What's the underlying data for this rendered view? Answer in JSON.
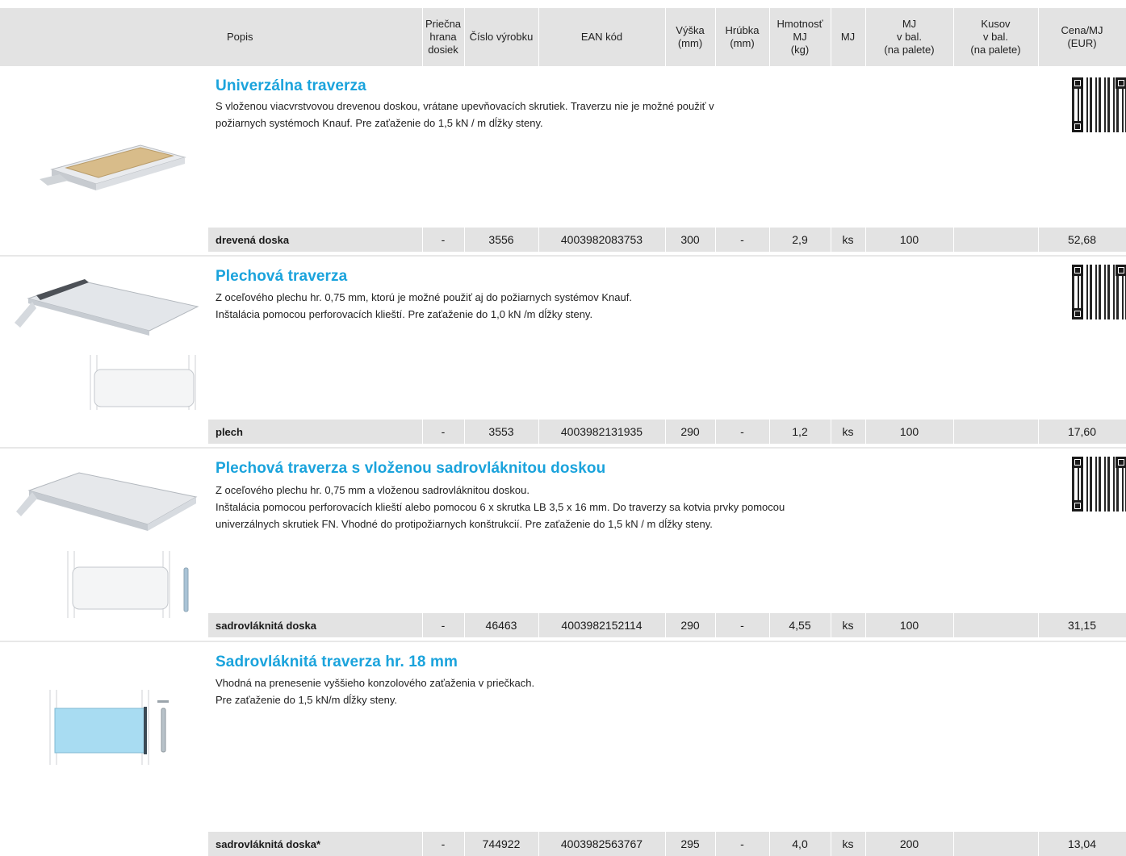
{
  "header": {
    "columns": [
      "Popis",
      "Priečna\nhrana\ndosiek",
      "Číslo výrobku",
      "EAN kód",
      "Výška\n(mm)",
      "Hrúbka\n(mm)",
      "Hmotnosť\nMJ\n(kg)",
      "MJ",
      "MJ\nv bal.\n(na palete)",
      "Kusov\nv bal.\n(na palete)",
      "Cena/MJ\n(EUR)"
    ]
  },
  "products": [
    {
      "title": "Univerzálna traverza",
      "desc": [
        "S vloženou viacvrstvovou drevenou doskou, vrátane upevňovacích skrutiek. Traverzu nie je možné použiť v",
        "požiarnych systémoch Knauf. Pre zaťaženie do 1,5 kN / m dĺžky steny."
      ],
      "row": [
        "drevená doska",
        "-",
        "3556",
        "4003982083753",
        "300",
        "-",
        "2,9",
        "ks",
        "100",
        "",
        "52,68"
      ]
    },
    {
      "title": "Plechová traverza",
      "desc": [
        "Z oceľového plechu hr. 0,75 mm, ktorú je možné použiť aj do požiarnych systémov Knauf.",
        "Inštalácia pomocou perforovacích klieští. Pre zaťaženie do 1,0 kN /m dĺžky steny."
      ],
      "row": [
        "plech",
        "-",
        "3553",
        "4003982131935",
        "290",
        "-",
        "1,2",
        "ks",
        "100",
        "",
        "17,60"
      ]
    },
    {
      "title": "Plechová traverza s vloženou sadrovláknitou doskou",
      "desc": [
        "Z oceľového plechu hr. 0,75 mm a vloženou sadrovláknitou doskou.",
        "Inštalácia pomocou perforovacích klieští alebo pomocou 6 x skrutka LB 3,5 x 16 mm. Do traverzy sa kotvia prvky pomocou",
        "univerzálnych skrutiek FN. Vhodné do protipožiarnych konštrukcií. Pre zaťaženie do 1,5 kN / m dĺžky steny."
      ],
      "row": [
        "sadrovláknitá doska",
        "-",
        "46463",
        "4003982152114",
        "290",
        "-",
        "4,55",
        "ks",
        "100",
        "",
        "31,15"
      ]
    },
    {
      "title": "Sadrovláknitá traverza hr. 18 mm",
      "desc": [
        "Vhodná na prenesenie vyššieho konzolového zaťaženia v priečkach.",
        "Pre zaťaženie do 1,5 kN/m dĺžky steny."
      ],
      "row": [
        "sadrovláknitá doska*",
        "-",
        "744922",
        "4003982563767",
        "295",
        "-",
        "4,0",
        "ks",
        "200",
        "",
        "13,04"
      ]
    }
  ]
}
